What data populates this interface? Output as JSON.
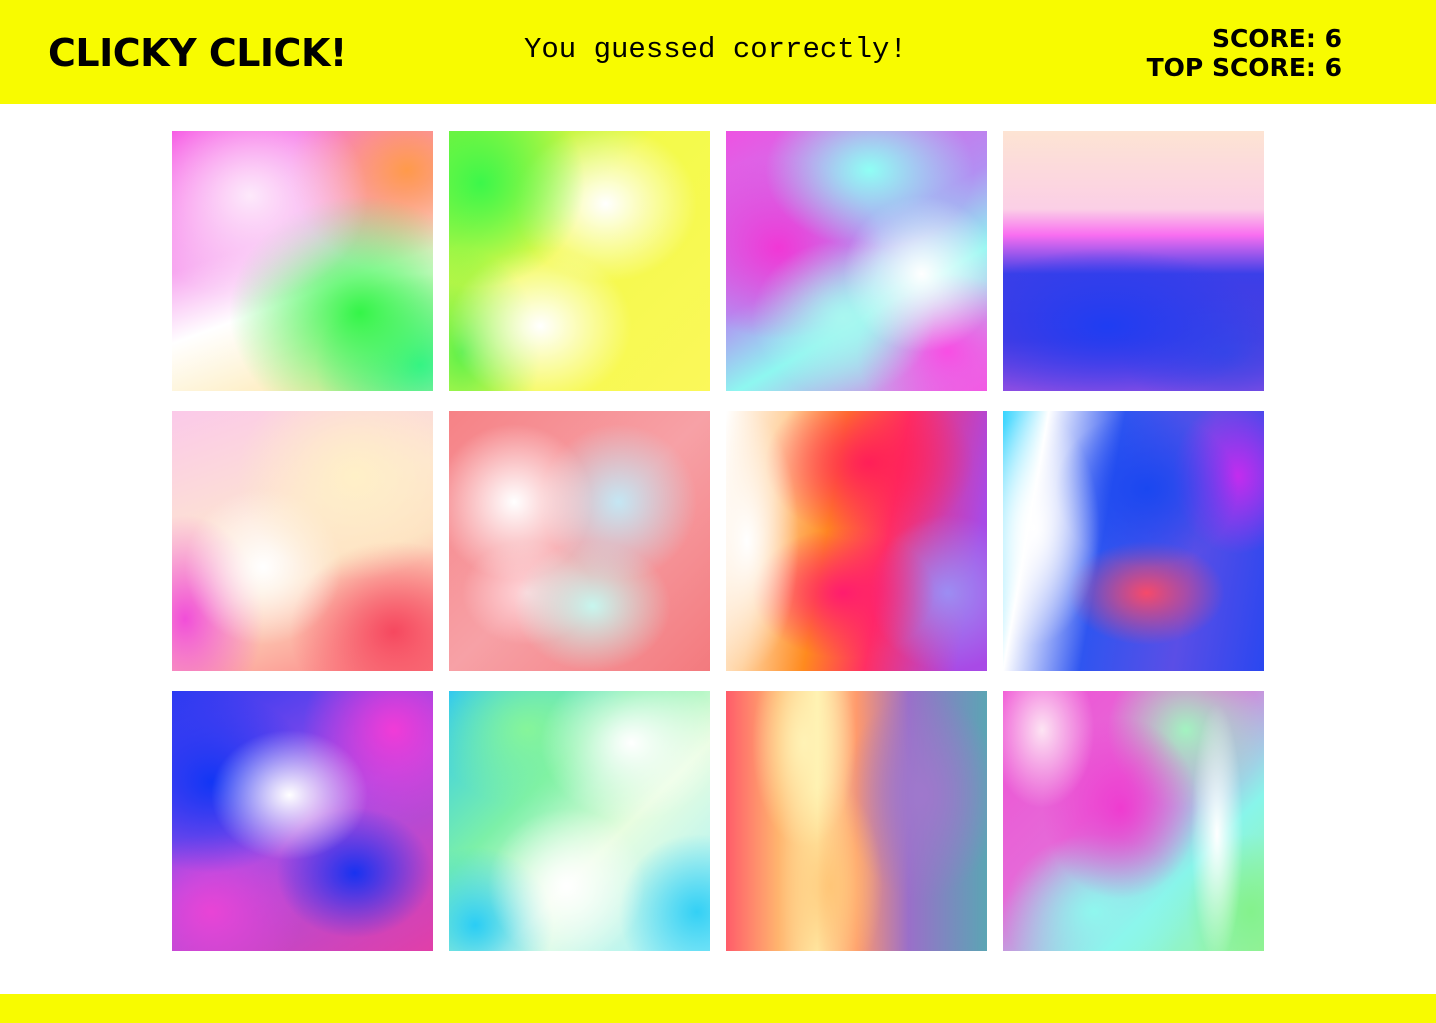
{
  "header": {
    "brand": "CLICKY CLICK!",
    "message": "You guessed correctly!",
    "score_label": "SCORE: ",
    "score_value": "6",
    "top_score_label": "TOP SCORE: ",
    "top_score_value": "6"
  },
  "colors": {
    "accent": "#f8fb00",
    "text": "#000000",
    "background": "#ffffff"
  },
  "tiles": [
    {
      "name": "gradient-image-1",
      "style": "g1"
    },
    {
      "name": "gradient-image-2",
      "style": "g2"
    },
    {
      "name": "gradient-image-3",
      "style": "g3"
    },
    {
      "name": "gradient-image-4",
      "style": "g4"
    },
    {
      "name": "gradient-image-5",
      "style": "g5"
    },
    {
      "name": "gradient-image-6",
      "style": "g6"
    },
    {
      "name": "gradient-image-7",
      "style": "g7"
    },
    {
      "name": "gradient-image-8",
      "style": "g8"
    },
    {
      "name": "gradient-image-9",
      "style": "g9"
    },
    {
      "name": "gradient-image-10",
      "style": "g10"
    },
    {
      "name": "gradient-image-11",
      "style": "g11"
    },
    {
      "name": "gradient-image-12",
      "style": "g12"
    }
  ]
}
